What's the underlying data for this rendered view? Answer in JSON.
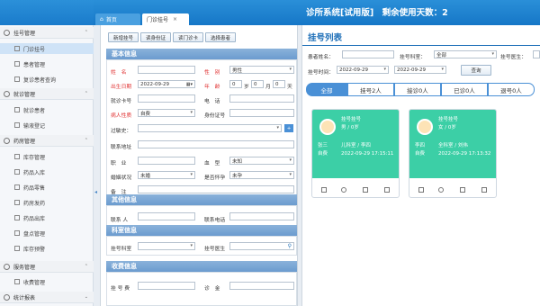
{
  "app": {
    "title": "诊所系统[试用版]　剩余使用天数：2"
  },
  "tabs": {
    "home": "首页",
    "registration": "门诊挂号",
    "close": "×"
  },
  "sidebar": {
    "groups": [
      "挂号管理",
      "就诊管理",
      "药房管理",
      "服务管理",
      "统计报表"
    ],
    "reg_items": [
      "门诊挂号",
      "患者管理",
      "复诊患者查询"
    ],
    "visit_items": [
      "就诊患者",
      "输液登记"
    ],
    "pharmacy_items": [
      "库存管理",
      "药品入库",
      "药品零售",
      "药房发药",
      "药品出库",
      "盘点管理",
      "库存预警"
    ],
    "service_items": [
      "收费管理"
    ]
  },
  "toolbar": {
    "new": "新增挂号",
    "read_id": "读身份证",
    "read_card": "读门诊卡",
    "select": "选择患者"
  },
  "form": {
    "basic_title": "基本信息",
    "name_label": "姓　名",
    "gender_label": "性　别",
    "gender_value": "男性",
    "dob_label": "出生日期",
    "dob_value": "2022-09-29",
    "age_label": "年　龄",
    "age_year": "0",
    "year_unit": "岁",
    "age_month": "0",
    "month_unit": "月",
    "age_day": "0",
    "day_unit": "天",
    "card_label": "就诊卡号",
    "phone_label": "电　话",
    "nature_label": "病人性质",
    "nature_value": "自费",
    "id_label": "身份证号",
    "allergy_label": "过敏史：",
    "plus": "+",
    "addr_label": "联系地址",
    "job_label": "职　业",
    "blood_label": "血　型",
    "blood_value": "未知",
    "marital_label": "婚姻状况",
    "marital_value": "未婚",
    "preg_label": "是否怀孕",
    "preg_value": "未孕",
    "note_label": "备　注",
    "other_title": "其他信息",
    "contact_label": "联系 人",
    "contact_phone_label": "联系电话",
    "dept_title": "科室信息",
    "dept_label": "挂号科室",
    "doctor_label": "挂号医生",
    "fee_title": "收费信息",
    "fee_label": "挂 号 费",
    "discount_label": "诊　金"
  },
  "list": {
    "title": "挂号列表",
    "patient_name_label": "患者姓名：",
    "dept_label": "挂号科室：",
    "dept_value": "全部",
    "doctor_label": "挂号医生：",
    "time_label": "挂号时间：",
    "date_from": "2022-09-29",
    "date_to": "2022-09-29",
    "query": "查询",
    "tabs": [
      "全部",
      "挂号2人",
      "接诊0人",
      "已诊0人",
      "退号0人"
    ],
    "cards": [
      {
        "title": "挂号挂号",
        "sub": "男 / 0岁",
        "name": "张三",
        "type": "自费",
        "dept": "儿科室 / 李四",
        "time": "2022-09-29 17:15:11"
      },
      {
        "title": "挂号挂号",
        "sub": "女 / 0岁",
        "name": "李四",
        "type": "自费",
        "dept": "全科室 / 刘伟",
        "time": "2022-09-29 17:13:32"
      }
    ]
  }
}
